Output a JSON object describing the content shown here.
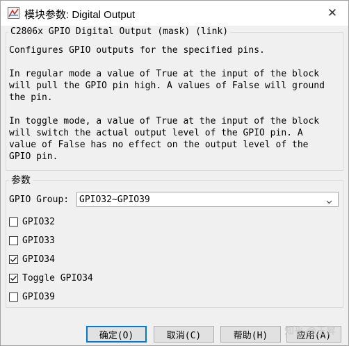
{
  "window": {
    "title": "模块参数: Digital Output",
    "close_glyph": "✕"
  },
  "description_group": {
    "title": "C2806x GPIO Digital Output (mask) (link)",
    "text": "Configures GPIO outputs for the specified pins.\n\nIn regular mode a value of True at the input of the block\nwill pull the GPIO pin high. A values of False will ground\nthe pin.\n\nIn toggle mode, a value of True at the input of the block\nwill switch the actual output level of the GPIO pin. A\nvalue of False has no effect on the output level of the\nGPIO pin."
  },
  "params_group": {
    "title": "参数",
    "gpio_group_label": "GPIO Group:",
    "gpio_group_value": "GPIO32~GPIO39",
    "checkboxes": [
      {
        "label": "GPIO32",
        "checked": false
      },
      {
        "label": "GPIO33",
        "checked": false
      },
      {
        "label": "GPIO34",
        "checked": true
      },
      {
        "label": "Toggle GPIO34",
        "checked": true
      },
      {
        "label": "GPIO39",
        "checked": false
      }
    ]
  },
  "buttons": {
    "ok": "确定(O)",
    "cancel": "取消(C)",
    "help": "帮助(H)",
    "apply": "应用(A)"
  },
  "watermark": "知乎 @玉昇",
  "colors": {
    "accent": "#0078d7",
    "button_bg": "#e1e1e1",
    "window_bg": "#f0f0f0"
  },
  "icons": {
    "app": "simulink-block-icon",
    "close": "close-icon",
    "dropdown": "chevron-down-icon",
    "check": "checkmark-icon"
  }
}
